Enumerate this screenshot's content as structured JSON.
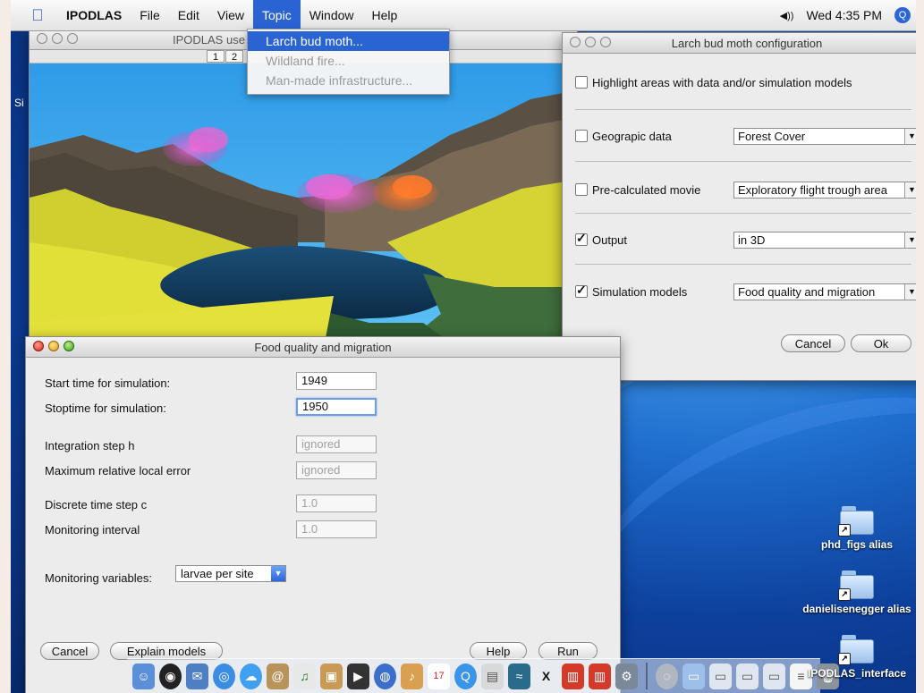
{
  "menubar": {
    "app_name": "IPODLAS",
    "items": [
      "File",
      "Edit",
      "View",
      "Topic",
      "Window",
      "Help"
    ],
    "clock": "Wed 4:35 PM",
    "volume_glyph": "◀))",
    "spotlight_glyph": "Q"
  },
  "topic_menu": {
    "items": [
      {
        "label": "Larch bud moth...",
        "state": "selected"
      },
      {
        "label": "Wildland fire...",
        "state": "disabled"
      },
      {
        "label": "Man-made infrastructure...",
        "state": "disabled"
      }
    ]
  },
  "viewer_window": {
    "title": "IPODLAS use",
    "tabs": [
      "1",
      "2"
    ],
    "edge_label": "Si"
  },
  "config_window": {
    "title": "Larch bud moth configuration",
    "highlight_label": "Highlight areas with data and/or simulation models",
    "highlight_checked": false,
    "rows": [
      {
        "label": "Geograpic data",
        "checked": false,
        "value": "Forest Cover"
      },
      {
        "label": "Pre-calculated movie",
        "checked": false,
        "value": "Exploratory flight trough area"
      },
      {
        "label": "Output",
        "checked": true,
        "value": "in 3D"
      },
      {
        "label": "Simulation models",
        "checked": true,
        "value": "Food quality and migration"
      }
    ],
    "cancel_label": "Cancel",
    "ok_label": "Ok"
  },
  "food_window": {
    "title": "Food quality and migration",
    "fields": [
      {
        "label": "Start time for simulation:",
        "value": "1949",
        "state": "normal"
      },
      {
        "label": "Stoptime for simulation:",
        "value": "1950",
        "state": "focused"
      },
      {
        "label": "Integration step h",
        "value": "ignored",
        "state": "disabled"
      },
      {
        "label": "Maximum relative local error",
        "value": "ignored",
        "state": "disabled"
      },
      {
        "label": "Discrete time step c",
        "value": "1.0",
        "state": "disabled"
      },
      {
        "label": "Monitoring interval",
        "value": "1.0",
        "state": "disabled"
      }
    ],
    "monitoring_label": "Monitoring variables:",
    "monitoring_value": "larvae per site",
    "buttons": {
      "cancel": "Cancel",
      "explain": "Explain models",
      "help": "Help",
      "run": "Run"
    }
  },
  "desktop_icons": [
    "phd_figs alias",
    "danielisenegger alias",
    "IPODLAS_interface"
  ],
  "dock": {
    "apps": [
      "finder-icon",
      "dashboard-icon",
      "mail-icon",
      "safari-icon",
      "ichat-icon",
      "address-book-icon",
      "itunes-icon",
      "iphoto-icon",
      "imovie-icon",
      "idvd-icon",
      "garageband-icon",
      "ical-icon",
      "quicktime-icon",
      "preview-icon",
      "ipodlas-app-icon",
      "x11-icon",
      "app-icon-1",
      "app-icon-2",
      "system-prefs-icon"
    ],
    "ical_date": "17",
    "x11_glyph": "X",
    "docs": [
      "disk-icon",
      "folder-icon",
      "window-icon-1",
      "window-icon-2",
      "window-icon-3",
      "document-icon",
      "trash-icon"
    ]
  },
  "colors": {
    "selection": "#2a63d2",
    "sky": "#3aa8ec",
    "lake": "#123a5c",
    "slopes": "#d8d832",
    "moth_cloud": "#e060c8",
    "fire_cloud": "#ff7a2a"
  }
}
